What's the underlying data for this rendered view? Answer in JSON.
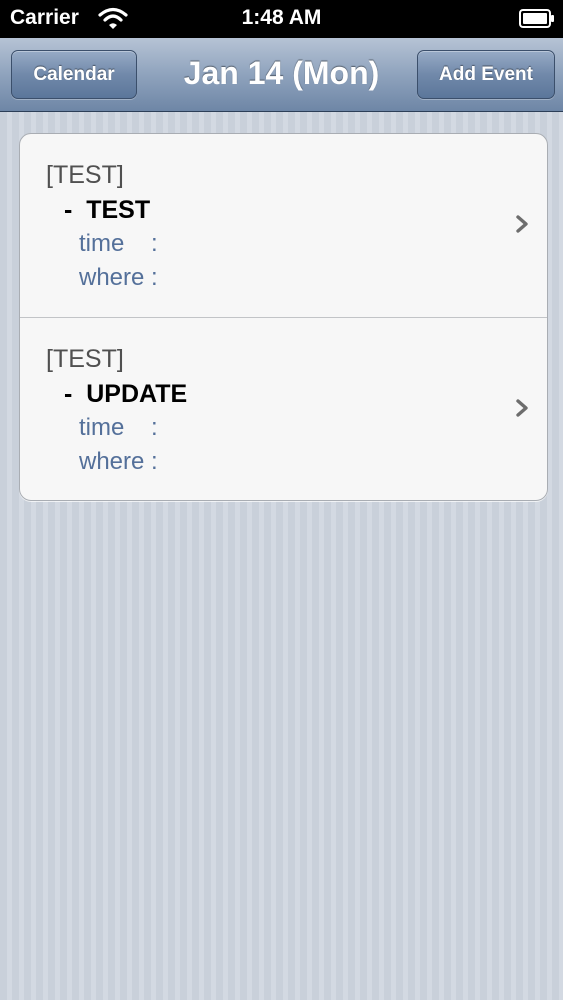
{
  "status_bar": {
    "carrier": "Carrier",
    "time": "1:48 AM"
  },
  "nav": {
    "title": "Jan 14 (Mon)",
    "left_button": "Calendar",
    "right_button": "Add Event"
  },
  "events": [
    {
      "category": "[TEST]",
      "title": "-  TEST",
      "time_label": "time    :",
      "where_label": "where :"
    },
    {
      "category": "[TEST]",
      "title": "-  UPDATE",
      "time_label": "time    :",
      "where_label": "where :"
    }
  ],
  "colors": {
    "nav_accent": "#7189aa",
    "detail_text": "#54709a",
    "background": "#cdd3dd"
  }
}
